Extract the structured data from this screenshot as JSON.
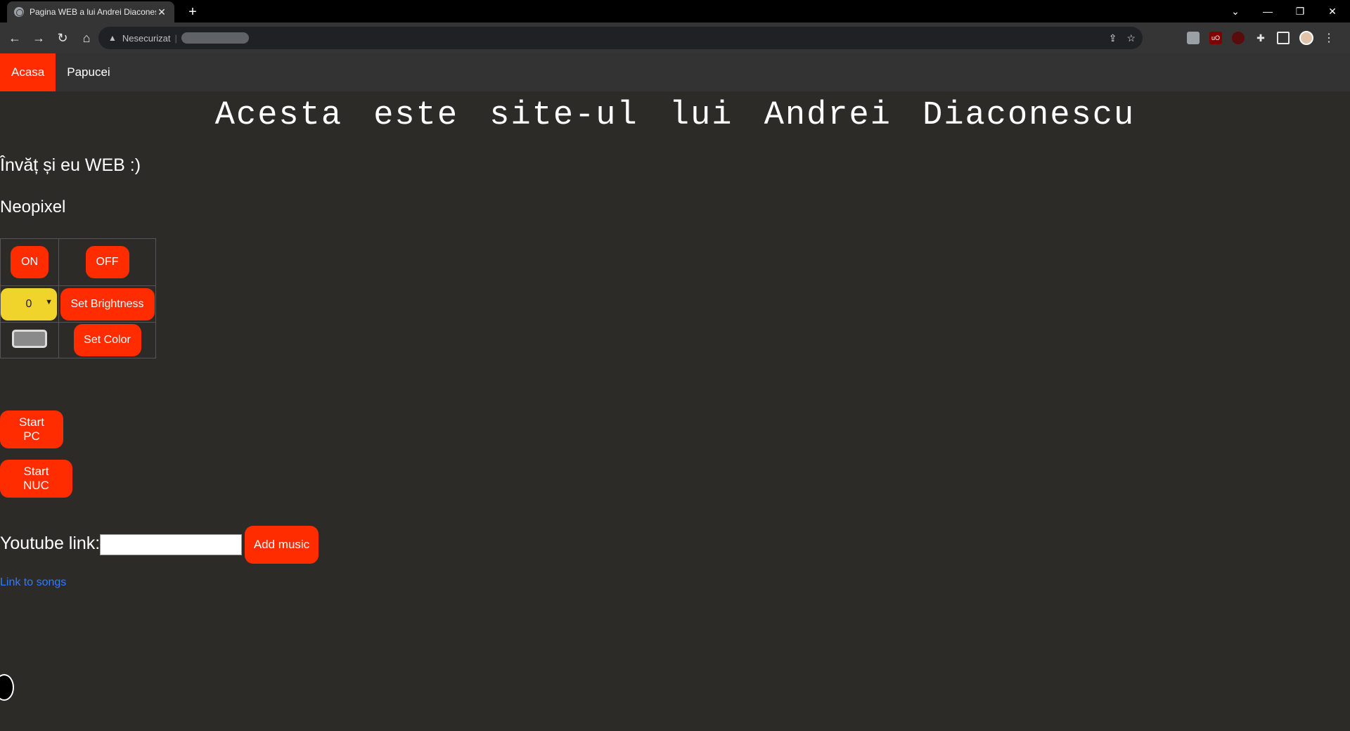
{
  "browser": {
    "tab_title": "Pagina WEB a lui Andrei Diaconescu",
    "tab_close": "✕",
    "new_tab": "+",
    "security_text": "Nesecurizat",
    "window_controls": {
      "minimize": "—",
      "restore": "❐",
      "close": "✕",
      "tab_search": "⌄"
    },
    "nav": {
      "back": "←",
      "forward": "→",
      "reload": "↻",
      "home": "⌂"
    },
    "extensions": [
      {
        "name": "extension-icon",
        "color": "#9aa0a6"
      },
      {
        "name": "ublock-icon",
        "color": "#800000",
        "text": "uO"
      },
      {
        "name": "extension-red-icon",
        "color": "#5a0b0b"
      }
    ]
  },
  "nav": {
    "items": [
      {
        "label": "Acasa",
        "active": true
      },
      {
        "label": "Papucei",
        "active": false
      }
    ]
  },
  "page": {
    "title": "Acesta este site-ul lui Andrei Diaconescu",
    "subtitle": "Învăț și eu WEB :)",
    "section": "Neopixel",
    "on_label": "ON",
    "off_label": "OFF",
    "brightness_value": "0",
    "set_brightness_label": "Set Brightness",
    "set_color_label": "Set Color",
    "color_value": "#8a8a8a",
    "start_pc_label": "Start PC",
    "start_nuc_label": "Start NUC",
    "youtube_label": "Youtube link:",
    "youtube_value": "",
    "add_music_label": "Add music",
    "songs_link": "Link to songs"
  },
  "colors": {
    "accent": "#ff2c00",
    "page_bg": "#2d2b28",
    "nav_bg": "#333333",
    "select_bg": "#f0d32b",
    "link": "#2e7cff"
  }
}
